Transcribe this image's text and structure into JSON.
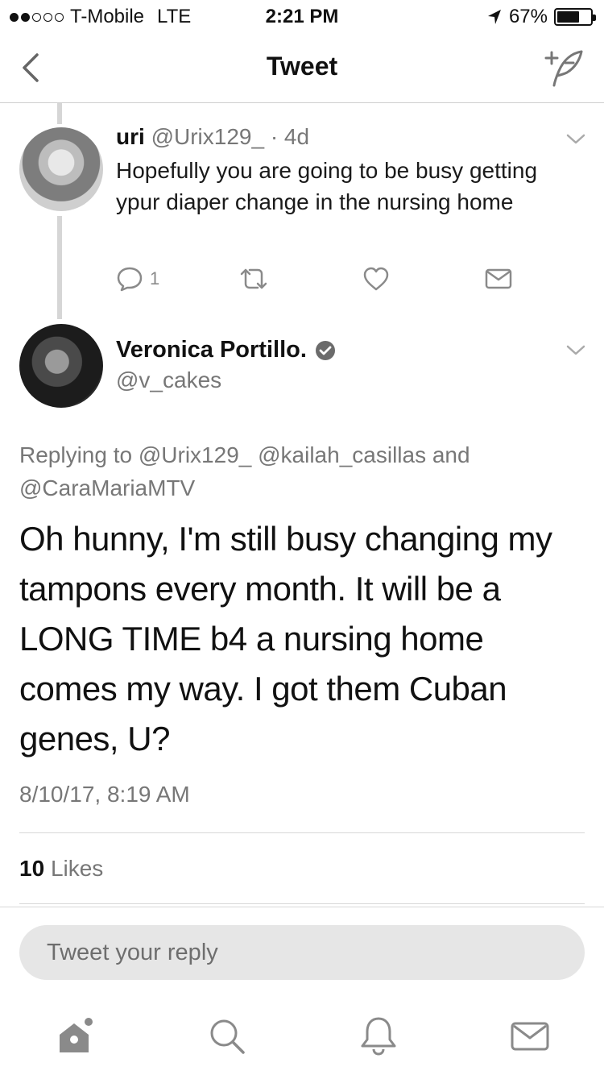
{
  "status_bar": {
    "carrier": "T-Mobile",
    "network": "LTE",
    "time": "2:21 PM",
    "battery_percent_label": "67%",
    "battery_level": 0.67,
    "signal_bars_filled": 2,
    "signal_bars_total": 5
  },
  "nav": {
    "title": "Tweet",
    "back_icon": "chevron-left-icon",
    "compose_icon": "compose-tweet-icon"
  },
  "parent_tweet": {
    "name": "uri",
    "handle": "@Urix129_",
    "age": "· 4d",
    "text": "Hopefully you are going to be busy getting ypur diaper  change in the nursing home",
    "reply_count": "1",
    "icons": [
      "reply-icon",
      "retweet-icon",
      "like-icon",
      "direct-message-icon"
    ]
  },
  "main_tweet": {
    "name": "Veronica Portillo.",
    "verified": true,
    "handle": "@v_cakes",
    "replying_to": "Replying to @Urix129_ @kailah_casillas and @CaraMariaMTV",
    "text": "Oh hunny, I'm still busy changing my tampons every month. It will be a LONG TIME b4 a nursing home comes my way. I got them Cuban genes, U?",
    "timestamp": "8/10/17, 8:19 AM",
    "likes_count": "10",
    "likes_label": "Likes"
  },
  "reply": {
    "placeholder": "Tweet your reply"
  },
  "tab_bar": {
    "tabs": [
      "home-icon",
      "search-icon",
      "notifications-icon",
      "messages-icon"
    ]
  },
  "colors": {
    "text": "#111111",
    "secondary": "#777777",
    "divider": "#d8d8d8",
    "reply_box": "#e6e6e6"
  }
}
